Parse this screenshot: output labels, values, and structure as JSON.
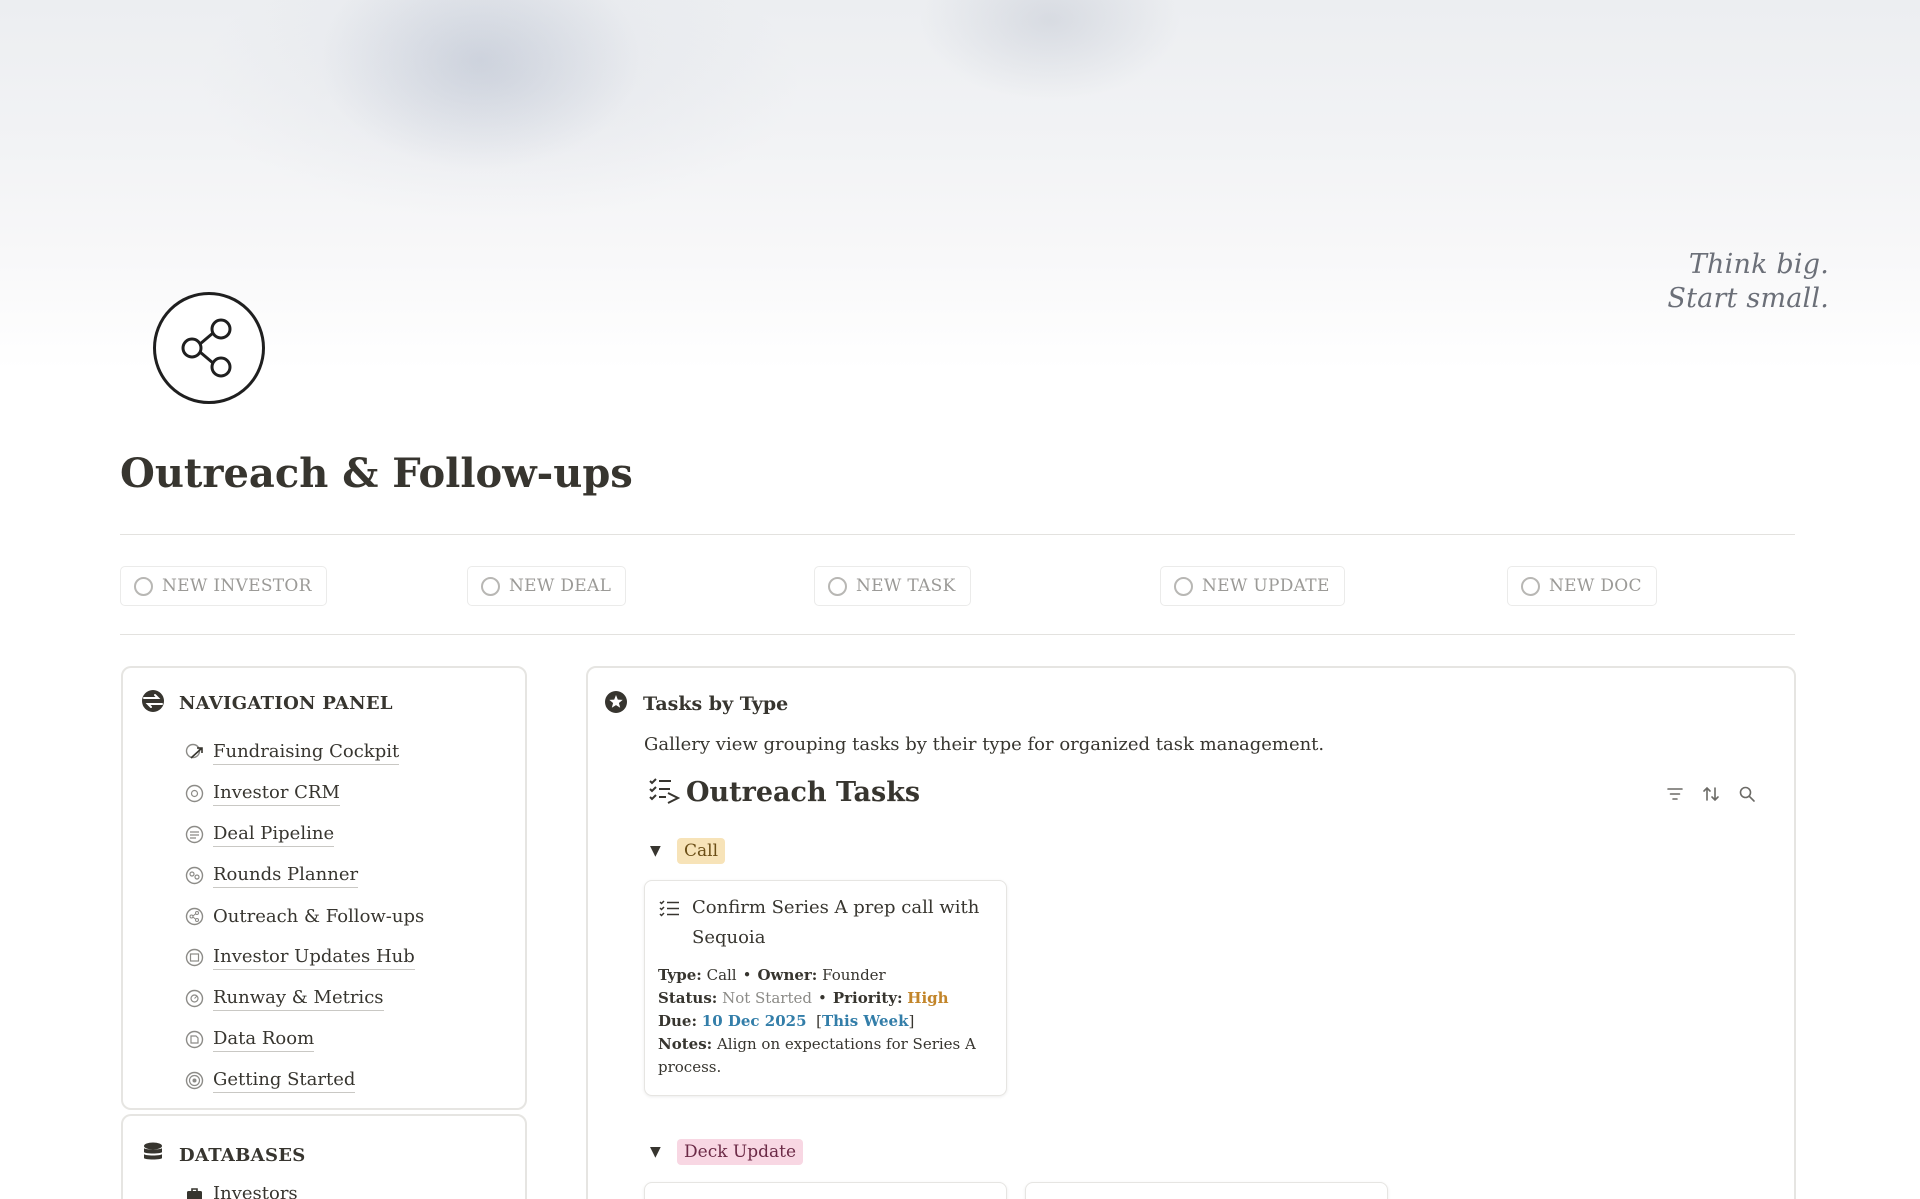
{
  "cover": {
    "tagline_line1": "Think big.",
    "tagline_line2": "Start small."
  },
  "page": {
    "icon": "share-icon",
    "title": "Outreach & Follow-ups"
  },
  "quick_actions": [
    {
      "label": "NEW INVESTOR"
    },
    {
      "label": "NEW DEAL"
    },
    {
      "label": "NEW TASK"
    },
    {
      "label": "NEW UPDATE"
    },
    {
      "label": "NEW DOC"
    }
  ],
  "navigation": {
    "title": "NAVIGATION PANEL",
    "icon": "compass-icon",
    "items": [
      {
        "label": "Fundraising Cockpit",
        "icon": "trend-icon"
      },
      {
        "label": "Investor CRM",
        "icon": "crm-icon"
      },
      {
        "label": "Deal Pipeline",
        "icon": "pipeline-icon"
      },
      {
        "label": "Rounds Planner",
        "icon": "rounds-icon"
      },
      {
        "label": "Outreach & Follow-ups",
        "icon": "share-icon"
      },
      {
        "label": "Investor Updates Hub",
        "icon": "updates-icon"
      },
      {
        "label": "Runway & Metrics",
        "icon": "metrics-icon"
      },
      {
        "label": "Data Room",
        "icon": "dataroom-icon"
      },
      {
        "label": "Getting Started",
        "icon": "start-icon"
      }
    ]
  },
  "databases": {
    "title": "DATABASES",
    "icon": "database-icon",
    "items": [
      {
        "label": "Investors",
        "icon": "briefcase-icon"
      }
    ]
  },
  "tasks_view": {
    "icon": "star-badge-icon",
    "title": "Tasks by Type",
    "description": "Gallery view grouping tasks by their type for organized task management.",
    "database_title": "Outreach Tasks",
    "database_icon": "checklist-icon",
    "tools": [
      "filter-icon",
      "sort-icon",
      "search-icon"
    ],
    "groups": [
      {
        "name": "Call",
        "cards": [
          {
            "title": "Confirm Series A prep call with Sequoia",
            "type_label": "Type:",
            "type": "Call",
            "owner_label": "Owner:",
            "owner": "Founder",
            "status_label": "Status:",
            "status": "Not Started",
            "priority_label": "Priority:",
            "priority": "High",
            "due_label": "Due:",
            "due": "10 Dec 2025",
            "due_tag": "This Week",
            "notes_label": "Notes:",
            "notes": "Align on expectations for Series A process."
          }
        ]
      },
      {
        "name": "Deck Update",
        "cards": []
      }
    ]
  },
  "colors": {
    "text": "#37352f",
    "muted": "#9b9a97",
    "priority_high": "#c2852a",
    "due": "#337ea9",
    "call_tag_bg": "#f7e3b8",
    "deck_tag_bg": "#f8d7e3"
  }
}
